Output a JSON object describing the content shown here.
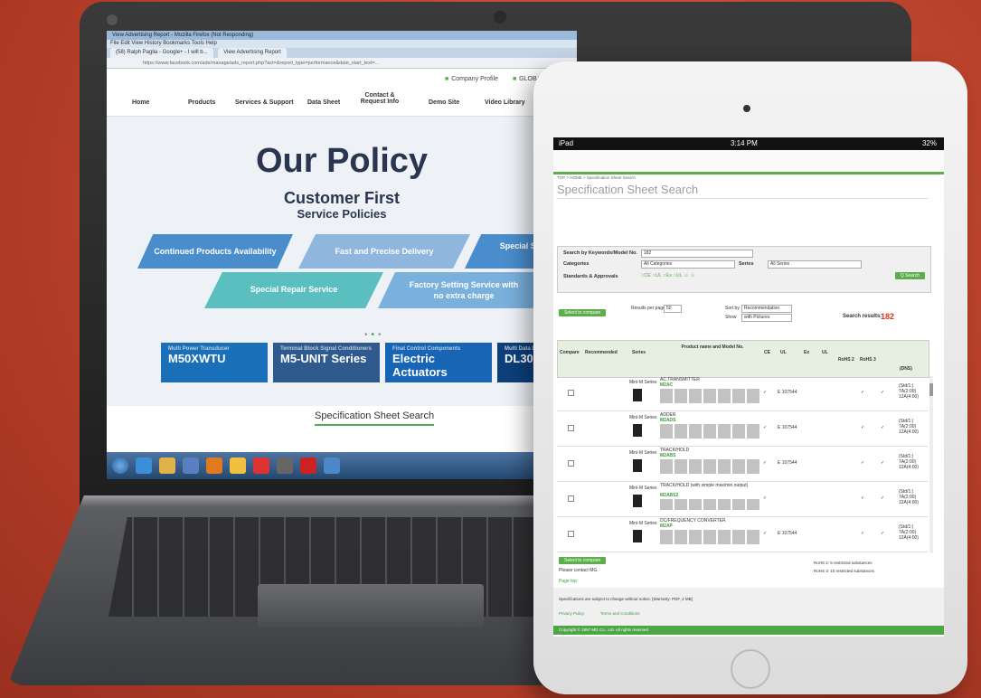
{
  "laptop": {
    "firefox": {
      "title": "View Advertising Report - Mozilla Firefox (Not Responding)",
      "menu": "File  Edit  View  History  Bookmarks  Tools  Help",
      "tabs": [
        "(58) Ralph Paglia - Google+ - I will b...",
        "View Advertising Report"
      ],
      "url": "https://www.facebook.com/ads/manage/ads_report.php?act=&report_type=performance&date_start_text=..."
    },
    "site": {
      "topbar": [
        "Company Profile",
        "GLOBAL"
      ],
      "nav": [
        "Home",
        "Products",
        "Services & Support",
        "Data Sheet",
        "Contact & Request Info",
        "Demo Site",
        "Video Library"
      ],
      "hero_title": "Our Policy",
      "hero_sub1": "Customer First",
      "hero_sub2": "Service Policies",
      "policies": [
        "Continued Products Availability",
        "Fast and Precise Delivery",
        "Special Service with",
        "Special Repair Service",
        "Factory Setting Service with no extra charge"
      ],
      "banners": [
        {
          "small": "Multi Power Transducer",
          "big": "M50XWTU"
        },
        {
          "small": "Terminal Block Signal Conditioners",
          "big": "M5-UNIT Series"
        },
        {
          "small": "Final Control Components",
          "big": "Electric Actuators"
        },
        {
          "small": "Multi Data Logger",
          "big": "DL30"
        }
      ],
      "spec_link": "Specification Sheet Search"
    }
  },
  "ipad": {
    "status": {
      "left": "iPad",
      "time": "3:14 PM",
      "battery": "32%"
    },
    "breadcrumb": "TOP > HOME > Specification Sheet Search",
    "page_title": "Specification Sheet Search",
    "form": {
      "keyword_label": "Search by Keywords/Model No.",
      "keyword_value": "182",
      "category_label": "Categories",
      "category_value": "All Categories",
      "series_label": "Series",
      "series_value": "All Series",
      "standards_label": "Standards & Approvals",
      "search_btn": "Q Search"
    },
    "compare_btn": "Select to compare",
    "results_per_page_label": "Results per page:",
    "results_per_page": "50",
    "sort_label": "Sort by",
    "sort_value": "Recommendation",
    "show_label": "Show",
    "show_value": "with Pictures",
    "results_label": "Search results:",
    "results_count": "182",
    "columns": [
      "Compare",
      "Recommended",
      "Series",
      "Product name and Model No.",
      "CE",
      "UL",
      "Ex",
      "UL",
      "RoHS 2",
      "RoHS 3",
      "(DNS)"
    ],
    "rows": [
      {
        "series": "Mini-M Series",
        "name": "AC TRANSMITTER",
        "model": "M2AC",
        "ul": "E 107544",
        "prices": [
          "(Std/1:)",
          "7A(2:00)",
          "12A(4:00)"
        ]
      },
      {
        "series": "Mini-M Series",
        "name": "ADDER",
        "model": "M2ADS",
        "ul": "E 107544",
        "prices": [
          "(Std/1:)",
          "7A(2:00)",
          "12A(4:00)"
        ]
      },
      {
        "series": "Mini-M Series",
        "name": "TRACK/HOLD",
        "model": "M2ABS",
        "ul": "E 107544",
        "prices": [
          "(Std/1:)",
          "7A(2:00)",
          "12A(4:00)"
        ]
      },
      {
        "series": "Mini-M Series",
        "name": "TRACK/HOLD (with simple max/min output)",
        "model": "M2ABS2",
        "ul": "",
        "prices": [
          "(Std/1:)",
          "7A(2:00)",
          "12A(4:00)"
        ]
      },
      {
        "series": "Mini-M Series",
        "name": "DC/FREQUENCY CONVERTER",
        "model": "M2AP",
        "ul": "E 107544",
        "prices": [
          "(Std/1:)",
          "7A(2:00)",
          "12A(4:00)"
        ]
      }
    ],
    "compare_btn_bottom": "Select to compare",
    "please_contact": "Please contact MG.",
    "rohs2_note": "RoHS 2: 6 restricted substances",
    "rohs3_note": "RoHS 3: 10 restricted substances",
    "page_top": "Page top",
    "footer_notice": "Specifications are subject to change without notice. [Warranty: PDF, 2 MB]",
    "footer_links": [
      "Privacy Policy",
      "Terms and Conditions"
    ],
    "copyright": "Copyright © 1997 MG Co., Ltd. All rights reserved."
  }
}
